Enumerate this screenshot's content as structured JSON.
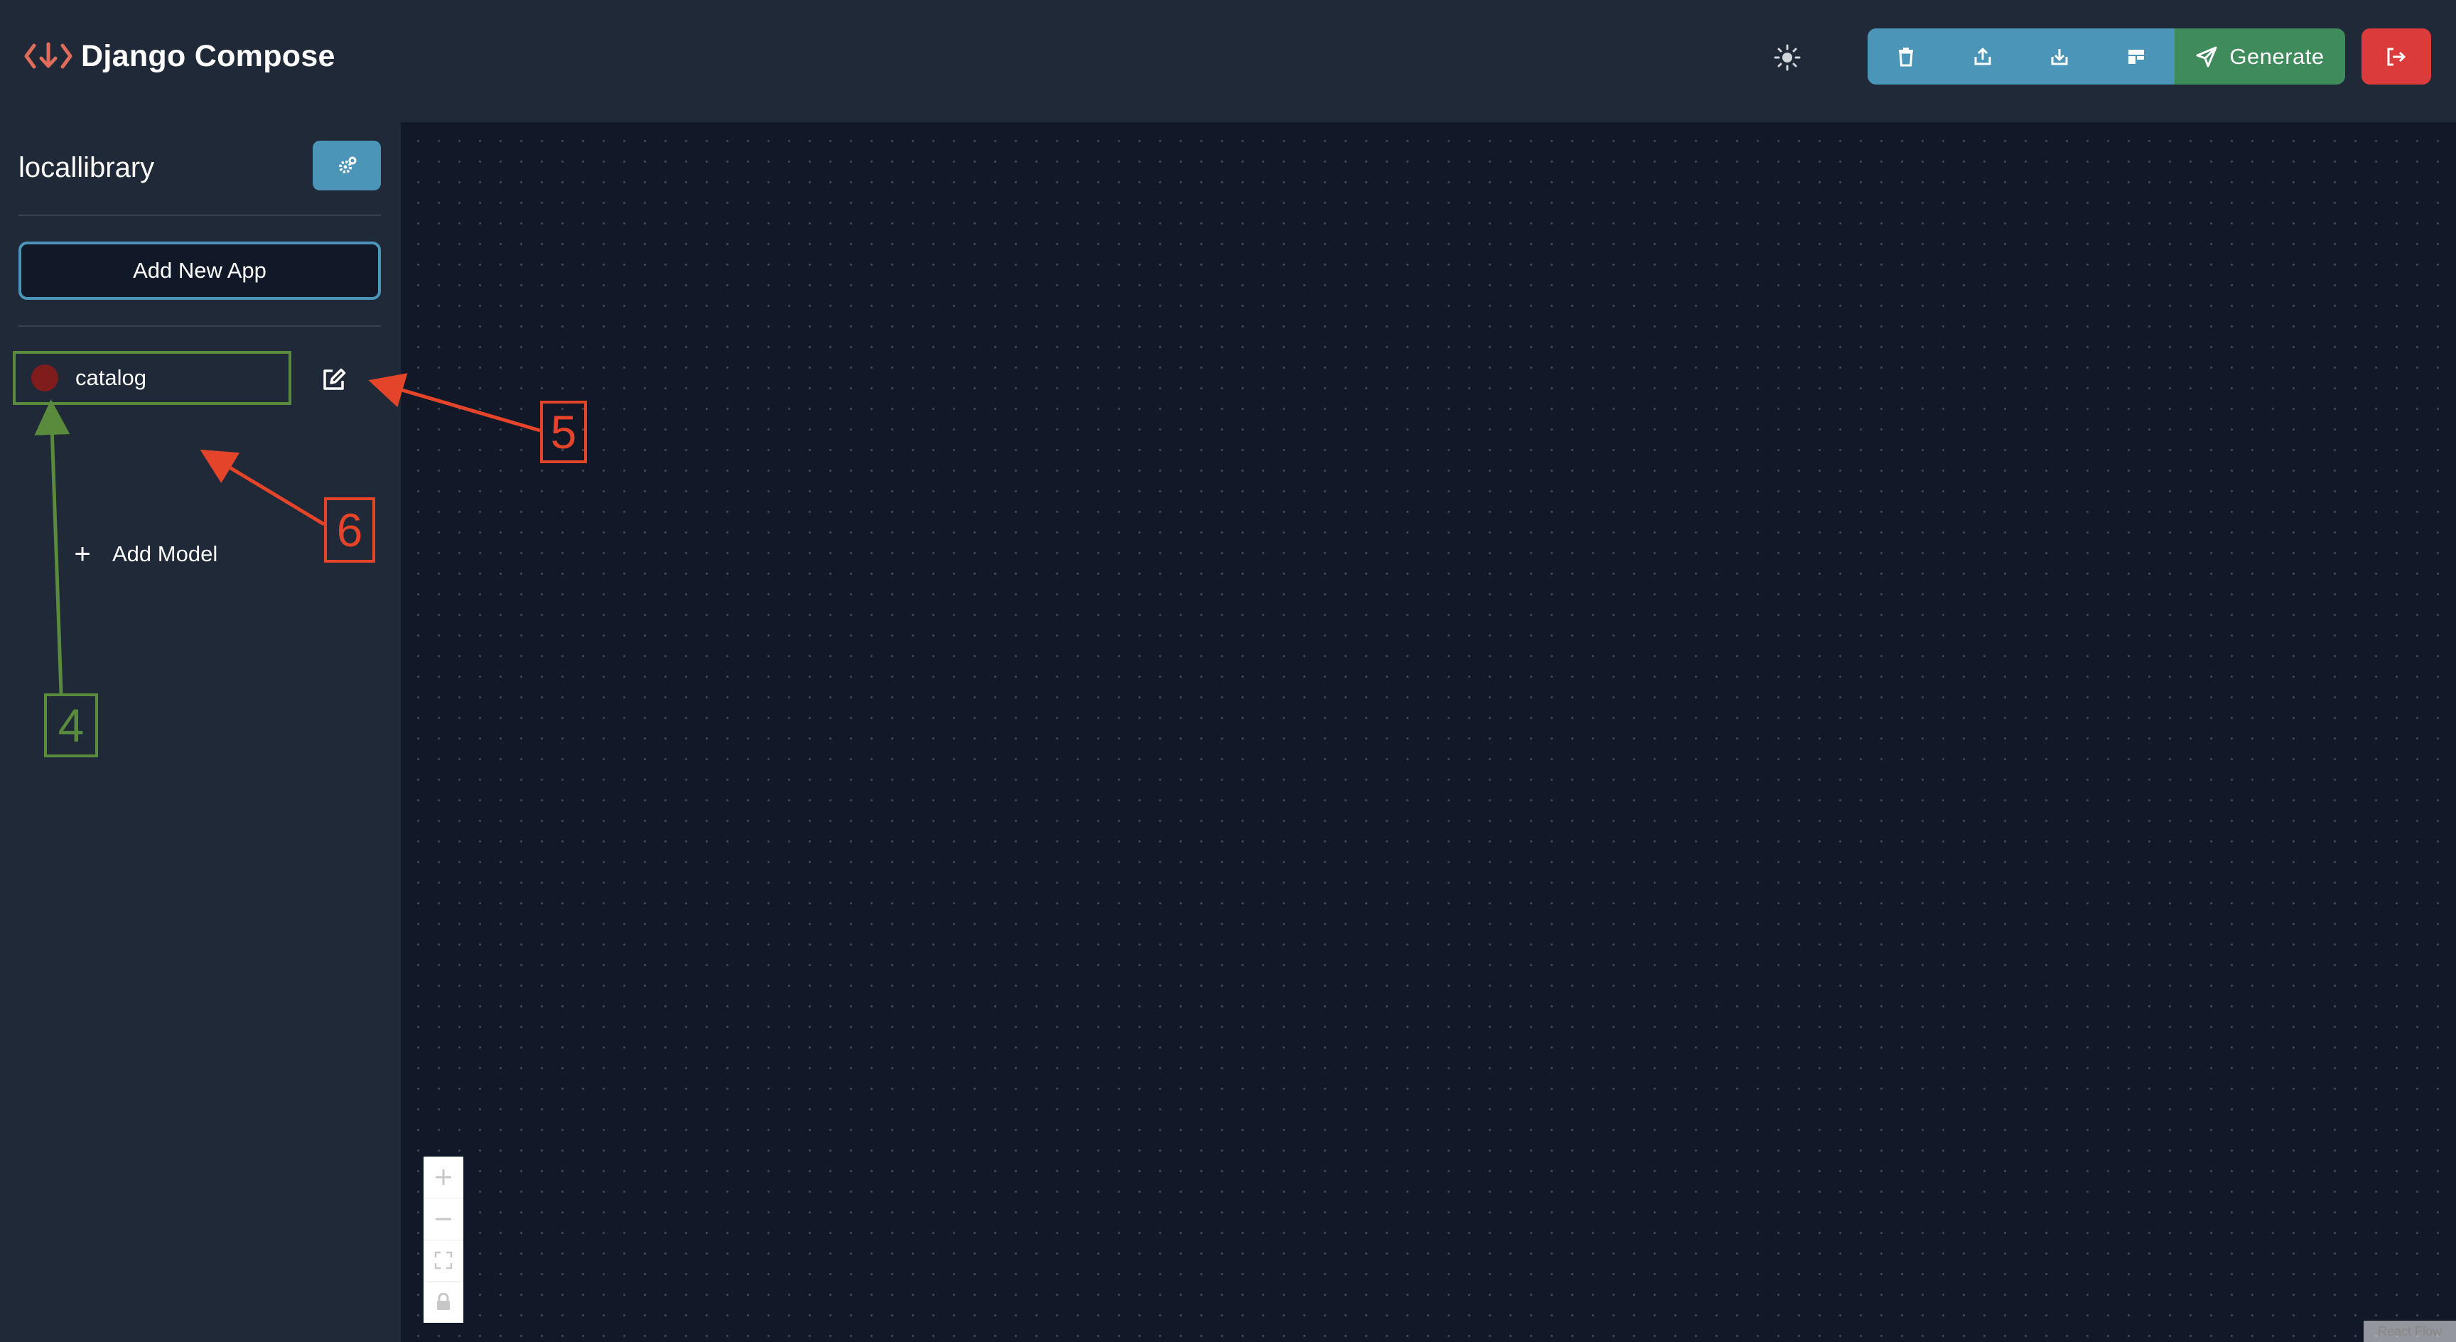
{
  "header": {
    "title": "Django Compose",
    "logo_icon": "code-download-icon",
    "theme_toggle_icon": "sun-icon",
    "toolbar": [
      {
        "name": "delete-button",
        "icon": "trash-icon"
      },
      {
        "name": "export-button",
        "icon": "upload-icon"
      },
      {
        "name": "import-button",
        "icon": "download-icon"
      },
      {
        "name": "layout-button",
        "icon": "layout-icon"
      }
    ],
    "generate_label": "Generate",
    "logout_icon": "sign-out-icon"
  },
  "sidebar": {
    "project_name": "locallibrary",
    "settings_icon": "gear-icon",
    "add_app_label": "Add New App",
    "apps": [
      {
        "name": "catalog",
        "dot_color": "#7f1d1d"
      }
    ],
    "add_model_label": "Add Model",
    "edit_icon": "edit-icon"
  },
  "canvas": {
    "zoom_controls": [
      "zoom-in-icon",
      "zoom-out-icon",
      "fit-view-icon",
      "lock-icon"
    ],
    "attribution": "React Flow"
  },
  "annotations": {
    "labels": [
      "4",
      "5",
      "6"
    ]
  },
  "colors": {
    "header_bg": "#1f2937",
    "canvas_bg": "#111827",
    "accent_blue": "#4a95b8",
    "generate_green": "#3f8b5c",
    "logout_red": "#dc3b3b",
    "annotation_red": "#e4452a",
    "annotation_green": "#5a8a3c"
  }
}
